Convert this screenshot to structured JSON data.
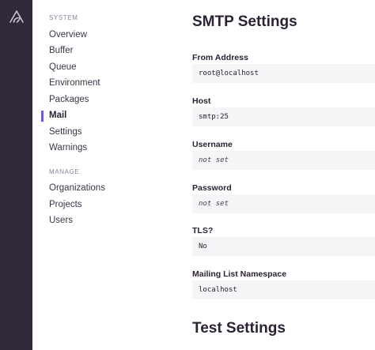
{
  "nav": {
    "system_heading": "SYSTEM",
    "system_items": [
      "Overview",
      "Buffer",
      "Queue",
      "Environment",
      "Packages",
      "Mail",
      "Settings",
      "Warnings"
    ],
    "active_item": "Mail",
    "manage_heading": "MANAGE",
    "manage_items": [
      "Organizations",
      "Projects",
      "Users"
    ]
  },
  "smtp": {
    "title": "SMTP Settings",
    "fields": [
      {
        "label": "From Address",
        "value": "root@localhost"
      },
      {
        "label": "Host",
        "value": "smtp:25"
      },
      {
        "label": "Username",
        "value": "not set"
      },
      {
        "label": "Password",
        "value": "not set"
      },
      {
        "label": "TLS?",
        "value": "No"
      },
      {
        "label": "Mailing List Namespace",
        "value": "localhost"
      }
    ]
  },
  "test": {
    "title": "Test Settings"
  },
  "colors": {
    "rail": "#2f2939",
    "accent": "#6c5fc7",
    "value_bg": "#f5f4f7"
  },
  "icons": {
    "logo": "sentry-logo-icon"
  }
}
